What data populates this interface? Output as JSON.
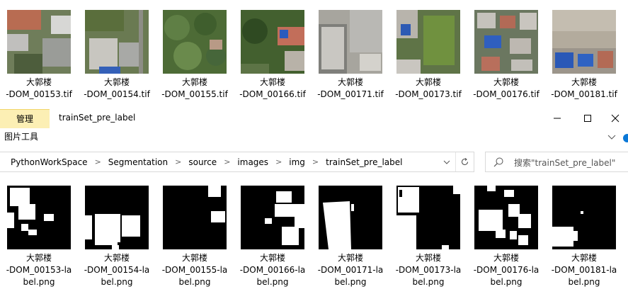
{
  "top_files": [
    {
      "line1": "大郭楼",
      "line2": "-DOM_00153.tif"
    },
    {
      "line1": "大郭楼",
      "line2": "-DOM_00154.tif"
    },
    {
      "line1": "大郭楼",
      "line2": "-DOM_00155.tif"
    },
    {
      "line1": "大郭楼",
      "line2": "-DOM_00166.tif"
    },
    {
      "line1": "大郭楼",
      "line2": "-DOM_00171.tif"
    },
    {
      "line1": "大郭楼",
      "line2": "-DOM_00173.tif"
    },
    {
      "line1": "大郭楼",
      "line2": "-DOM_00176.tif"
    },
    {
      "line1": "大郭楼",
      "line2": "-DOM_00181.tif"
    }
  ],
  "ribbon": {
    "manage_tab": "管理",
    "picture_tools": "图片工具",
    "window_title": "trainSet_pre_label"
  },
  "address": {
    "crumbs": [
      "PythonWorkSpace",
      "Segmentation",
      "source",
      "images",
      "img",
      "trainSet_pre_label"
    ]
  },
  "search": {
    "placeholder": "搜索\"trainSet_pre_label\""
  },
  "label_files": [
    {
      "line1": "大郭楼",
      "line2": "-DOM_00153-la",
      "line3": "bel.png"
    },
    {
      "line1": "大郭楼",
      "line2": "-DOM_00154-la",
      "line3": "bel.png"
    },
    {
      "line1": "大郭楼",
      "line2": "-DOM_00155-la",
      "line3": "bel.png"
    },
    {
      "line1": "大郭楼",
      "line2": "-DOM_00166-la",
      "line3": "bel.png"
    },
    {
      "line1": "大郭楼",
      "line2": "-DOM_00171-la",
      "line3": "bel.png"
    },
    {
      "line1": "大郭楼",
      "line2": "-DOM_00173-la",
      "line3": "bel.png"
    },
    {
      "line1": "大郭楼",
      "line2": "-DOM_00176-la",
      "line3": "bel.png"
    },
    {
      "line1": "大郭楼",
      "line2": "-DOM_00181-la",
      "line3": "bel.png"
    }
  ],
  "colors": {
    "manage_tab_bg": "#fcefb4",
    "accent": "#0a78d7"
  }
}
